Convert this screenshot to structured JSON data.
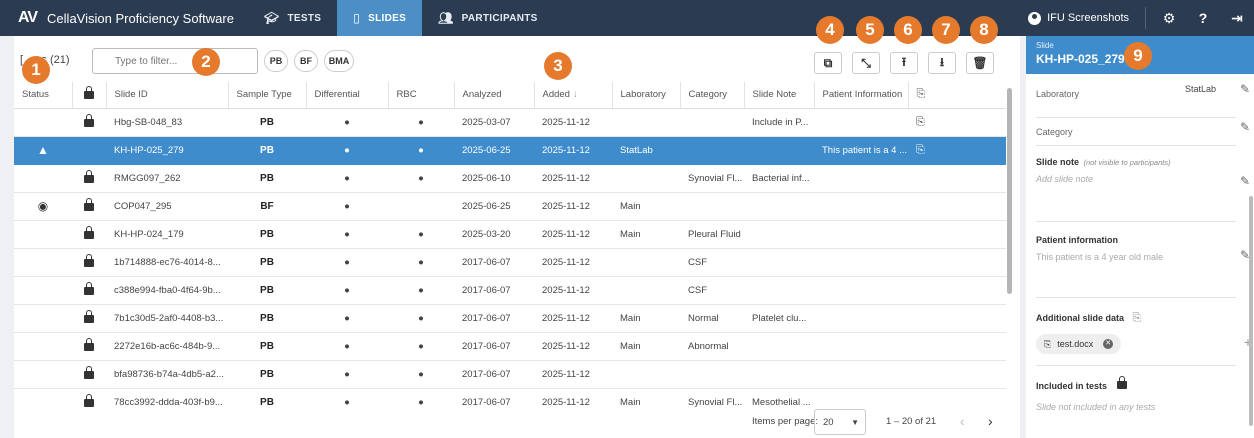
{
  "app": {
    "logo": "AV",
    "title": "CellaVision Proficiency Software",
    "tabs": [
      {
        "label": "TESTS",
        "icon": "graduation-cap-icon",
        "active": false
      },
      {
        "label": "SLIDES",
        "icon": "slides-icon",
        "active": true
      },
      {
        "label": "PARTICIPANTS",
        "icon": "participants-icon",
        "active": false
      }
    ],
    "user": "IFU Screenshots",
    "accent_color": "#3f8ccc",
    "topbar_color": "#2b3b52"
  },
  "toolbar": {
    "title_prefix": "[",
    "title_suffix": "s",
    "count": "(21)",
    "filter_placeholder": "Type to filter...",
    "sample_filters": [
      "PB",
      "BF",
      "BMA"
    ]
  },
  "table": {
    "columns": [
      "Status",
      "",
      "Slide ID",
      "Sample Type",
      "Differential",
      "RBC",
      "Analyzed",
      "Added",
      "Laboratory",
      "Category",
      "Slide Note",
      "Patient Information",
      ""
    ],
    "sort_indicator": "↓",
    "rows": [
      {
        "status": "",
        "locked": true,
        "id": "Hbg-SB-048_83",
        "type": "PB",
        "diff": "●",
        "rbc": "●",
        "analyzed": "2025-03-07",
        "added": "2025-11-12",
        "lab": "",
        "category": "",
        "note": "Include in P...",
        "patient": "",
        "attach": true,
        "selected": false
      },
      {
        "status": "warning",
        "locked": false,
        "id": "KH-HP-025_279",
        "type": "PB",
        "diff": "●",
        "rbc": "●",
        "analyzed": "2025-06-25",
        "added": "2025-11-12",
        "lab": "StatLab",
        "category": "",
        "note": "",
        "patient": "This patient is a 4 ...",
        "attach": true,
        "selected": true
      },
      {
        "status": "",
        "locked": true,
        "id": "RMGG097_262",
        "type": "PB",
        "diff": "●",
        "rbc": "●",
        "analyzed": "2025-06-10",
        "added": "2025-11-12",
        "lab": "",
        "category": "Synovial Fl...",
        "note": "Bacterial inf...",
        "patient": "",
        "attach": false,
        "selected": false
      },
      {
        "status": "eye",
        "locked": true,
        "id": "COP047_295",
        "type": "BF",
        "diff": "●",
        "rbc": "",
        "analyzed": "2025-06-25",
        "added": "2025-11-12",
        "lab": "Main",
        "category": "",
        "note": "",
        "patient": "",
        "attach": false,
        "selected": false
      },
      {
        "status": "",
        "locked": true,
        "id": "KH-HP-024_179",
        "type": "PB",
        "diff": "●",
        "rbc": "●",
        "analyzed": "2025-03-20",
        "added": "2025-11-12",
        "lab": "Main",
        "category": "Pleural Fluid",
        "note": "",
        "patient": "",
        "attach": false,
        "selected": false
      },
      {
        "status": "",
        "locked": true,
        "id": "1b714888-ec76-4014-8...",
        "type": "PB",
        "diff": "●",
        "rbc": "●",
        "analyzed": "2017-06-07",
        "added": "2025-11-12",
        "lab": "",
        "category": "CSF",
        "note": "",
        "patient": "",
        "attach": false,
        "selected": false
      },
      {
        "status": "",
        "locked": true,
        "id": "c388e994-fba0-4f64-9b...",
        "type": "PB",
        "diff": "●",
        "rbc": "●",
        "analyzed": "2017-06-07",
        "added": "2025-11-12",
        "lab": "",
        "category": "CSF",
        "note": "",
        "patient": "",
        "attach": false,
        "selected": false
      },
      {
        "status": "",
        "locked": true,
        "id": "7b1c30d5-2af0-4408-b3...",
        "type": "PB",
        "diff": "●",
        "rbc": "●",
        "analyzed": "2017-06-07",
        "added": "2025-11-12",
        "lab": "Main",
        "category": "Normal",
        "note": "Platelet clu...",
        "patient": "",
        "attach": false,
        "selected": false
      },
      {
        "status": "",
        "locked": true,
        "id": "2272e16b-ac6c-484b-9...",
        "type": "PB",
        "diff": "●",
        "rbc": "●",
        "analyzed": "2017-06-07",
        "added": "2025-11-12",
        "lab": "Main",
        "category": "Abnormal",
        "note": "",
        "patient": "",
        "attach": false,
        "selected": false
      },
      {
        "status": "",
        "locked": true,
        "id": "bfa98736-b74a-4db5-a2...",
        "type": "PB",
        "diff": "●",
        "rbc": "●",
        "analyzed": "2017-06-07",
        "added": "2025-11-12",
        "lab": "",
        "category": "",
        "note": "",
        "patient": "",
        "attach": false,
        "selected": false
      },
      {
        "status": "",
        "locked": true,
        "id": "78cc3992-ddda-403f-b9...",
        "type": "PB",
        "diff": "●",
        "rbc": "●",
        "analyzed": "2017-06-07",
        "added": "2025-11-12",
        "lab": "Main",
        "category": "Synovial Fl...",
        "note": "Mesothelial ...",
        "patient": "",
        "attach": false,
        "selected": false
      }
    ]
  },
  "pager": {
    "label": "Items per page:",
    "per_page": "20",
    "range": "1 – 20 of 21",
    "prev": "‹",
    "next": "›"
  },
  "side": {
    "label": "Slide",
    "slide_id": "KH-HP-025_279",
    "laboratory_label": "Laboratory",
    "laboratory_value": "StatLab",
    "category_label": "Category",
    "note_label": "Slide note",
    "note_sub": "(not visible to participants)",
    "note_placeholder": "Add slide note",
    "patient_label": "Patient information",
    "patient_value": "This patient is a 4 year old male",
    "additional_label": "Additional slide data",
    "attachment": "test.docx",
    "included_label": "Included in tests",
    "included_value": "Slide not included in any tests"
  },
  "markers": [
    "1",
    "2",
    "3",
    "4",
    "5",
    "6",
    "7",
    "8",
    "9"
  ]
}
